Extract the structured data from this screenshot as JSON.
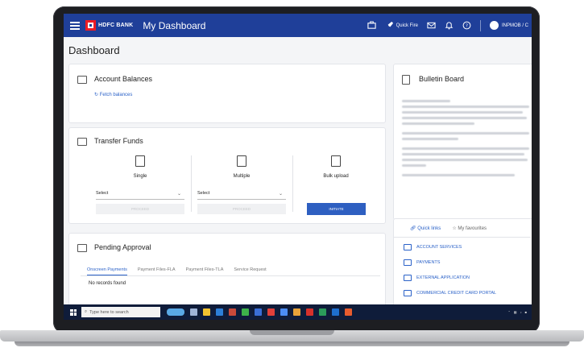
{
  "topbar": {
    "brand": "HDFC BANK",
    "title": "My Dashboard",
    "quick_fire": "Quick Fire",
    "user": "INPMOB / C"
  },
  "page": {
    "title": "Dashboard"
  },
  "account_balances": {
    "title": "Account Balances",
    "fetch_label": "Fetch balances"
  },
  "transfer_funds": {
    "title": "Transfer Funds",
    "single": {
      "label": "Single",
      "select": "Select",
      "proceed": "PROCEED"
    },
    "multiple": {
      "label": "Multiple",
      "select": "Select",
      "proceed": "PROCEED"
    },
    "bulk": {
      "label": "Bulk upload",
      "button": "INITIATE"
    }
  },
  "pending_approval": {
    "title": "Pending Approval",
    "tabs": [
      "Onscreen Payments",
      "Payment Files-FLA",
      "Payment Files-TLA",
      "Service Request"
    ],
    "empty": "No records found"
  },
  "bulletin": {
    "title": "Bulletin Board"
  },
  "quick_links": {
    "tabs": [
      "Quick links",
      "My favourites"
    ],
    "items": [
      "ACCOUNT SERVICES",
      "PAYMENTS",
      "EXTERNAL APPLICATION",
      "COMMERCIAL CREDIT CARD PORTAL"
    ]
  },
  "taskbar": {
    "search_placeholder": "Type here to search"
  },
  "colors": {
    "brand_blue": "#1f3f99",
    "accent": "#2e5fc1",
    "logo_red": "#ed1c24"
  }
}
